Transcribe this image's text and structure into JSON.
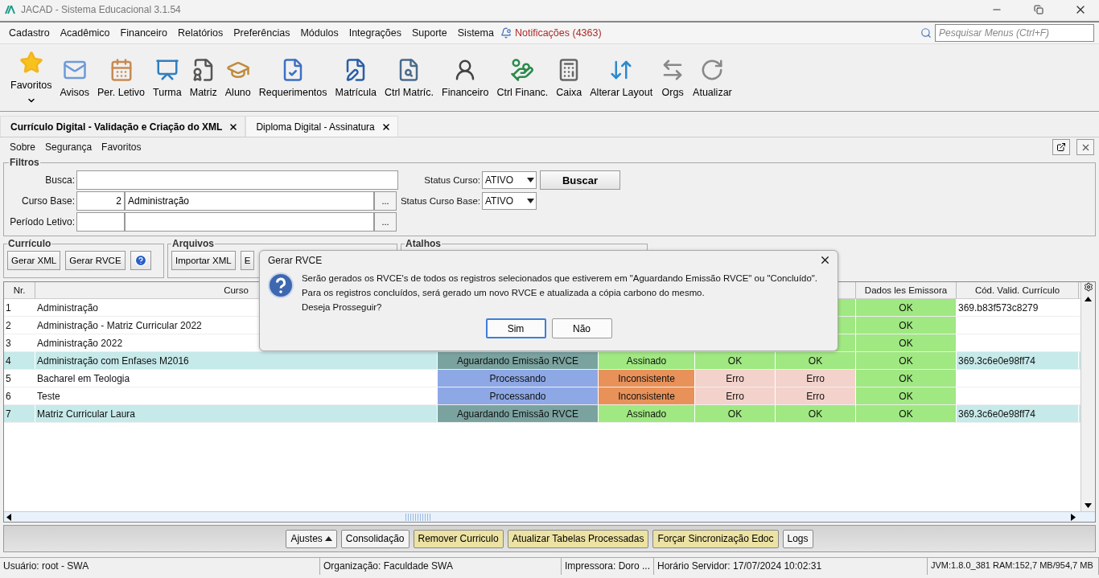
{
  "window": {
    "title": "JACAD - Sistema Educacional 3.1.54"
  },
  "menu": [
    "Cadastro",
    "Acadêmico",
    "Financeiro",
    "Relatórios",
    "Preferências",
    "Módulos",
    "Integrações",
    "Suporte",
    "Sistema"
  ],
  "notifications": "Notificações (4363)",
  "menu_search": {
    "placeholder": "Pesquisar Menus (Ctrl+F)"
  },
  "toolbar": [
    {
      "label": "Favoritos"
    },
    {
      "label": "Avisos"
    },
    {
      "label": "Per. Letivo"
    },
    {
      "label": "Turma"
    },
    {
      "label": "Matriz"
    },
    {
      "label": "Aluno"
    },
    {
      "label": "Requerimentos"
    },
    {
      "label": "Matrícula"
    },
    {
      "label": "Ctrl Matríc."
    },
    {
      "label": "Financeiro"
    },
    {
      "label": "Ctrl Financ."
    },
    {
      "label": "Caixa"
    },
    {
      "label": "Alterar Layout"
    },
    {
      "label": "Orgs"
    },
    {
      "label": "Atualizar"
    }
  ],
  "tabs": [
    {
      "label": "Currículo Digital - Validação e Criação do XML",
      "selected": true
    },
    {
      "label": "Diploma Digital - Assinatura",
      "selected": false
    }
  ],
  "submenu": [
    "Sobre",
    "Segurança",
    "Favoritos"
  ],
  "filters": {
    "title": "Filtros",
    "busca": {
      "label": "Busca:"
    },
    "curso_base": {
      "label": "Curso Base:",
      "code": "2",
      "name": "Administração",
      "lookup": "..."
    },
    "periodo": {
      "label": "Período Letivo:",
      "lookup": "..."
    },
    "status_curso": {
      "label": "Status Curso:",
      "value": "ATIVO"
    },
    "status_base": {
      "label": "Status Curso Base:",
      "value": "ATIVO"
    },
    "search_button": "Buscar"
  },
  "groups": [
    {
      "title": "Currículo",
      "buttons": [
        "Gerar XML",
        "Gerar RVCE"
      ]
    },
    {
      "title": "Arquivos",
      "buttons": [
        "Importar XML",
        "E"
      ]
    },
    {
      "title": "Atalhos"
    }
  ],
  "table": {
    "columns": [
      {
        "label": "Nr."
      },
      {
        "label": "Curso"
      },
      {},
      {},
      {},
      {},
      {
        "label": "Dados les Emissora"
      },
      {
        "label": "Cód. Valid. Currículo"
      }
    ],
    "rows": [
      {
        "nr": "1",
        "curso": "Administração",
        "selected": false,
        "cells": [
          null,
          null,
          null,
          {
            "color": "#a0e882"
          },
          {
            "text": "OK",
            "color": "#a0e882"
          },
          {
            "text": "369.b83f573c8279"
          }
        ]
      },
      {
        "nr": "2",
        "curso": "Administração - Matriz Curricular 2022",
        "selected": false,
        "cells": [
          null,
          null,
          null,
          {
            "color": "#a0e882"
          },
          {
            "text": "OK",
            "color": "#a0e882"
          },
          null
        ]
      },
      {
        "nr": "3",
        "curso": "Administração 2022",
        "selected": false,
        "cells": [
          null,
          null,
          null,
          {
            "color": "#a0e882"
          },
          {
            "text": "OK",
            "color": "#a0e882"
          },
          null
        ]
      },
      {
        "nr": "4",
        "curso": "Administração com Enfases M2016",
        "selected": true,
        "cells": [
          {
            "text": "Aguardando Emissão RVCE",
            "color": "#7aa3a0"
          },
          {
            "text": "Assinado",
            "color": "#a0e882"
          },
          {
            "text": "OK",
            "color": "#a0e882"
          },
          {
            "text": "OK",
            "color": "#a0e882"
          },
          {
            "text": "OK",
            "color": "#a0e882"
          },
          {
            "text": "369.3c6e0e98ff74"
          }
        ]
      },
      {
        "nr": "5",
        "curso": "Bacharel em Teologia",
        "selected": false,
        "cells": [
          {
            "text": "Processando",
            "color": "#8ea8e6"
          },
          {
            "text": "Inconsistente",
            "color": "#e8925a"
          },
          {
            "text": "Erro",
            "color": "#f3d2cb"
          },
          {
            "text": "Erro",
            "color": "#f3d2cb"
          },
          {
            "text": "OK",
            "color": "#a0e882"
          },
          null
        ]
      },
      {
        "nr": "6",
        "curso": "Teste",
        "selected": false,
        "cells": [
          {
            "text": "Processando",
            "color": "#8ea8e6"
          },
          {
            "text": "Inconsistente",
            "color": "#e8925a"
          },
          {
            "text": "Erro",
            "color": "#f3d2cb"
          },
          {
            "text": "Erro",
            "color": "#f3d2cb"
          },
          {
            "text": "OK",
            "color": "#a0e882"
          },
          null
        ]
      },
      {
        "nr": "7",
        "curso": "Matriz Curricular Laura",
        "selected": true,
        "cells": [
          {
            "text": "Aguardando Emissão RVCE",
            "color": "#7aa3a0"
          },
          {
            "text": "Assinado",
            "color": "#a0e882"
          },
          {
            "text": "OK",
            "color": "#a0e882"
          },
          {
            "text": "OK",
            "color": "#a0e882"
          },
          {
            "text": "OK",
            "color": "#a0e882"
          },
          {
            "text": "369.3c6e0e98ff74"
          }
        ]
      }
    ]
  },
  "actions": [
    {
      "label": "Ajustes",
      "highlighted": false
    },
    {
      "label": "Consolidação",
      "highlighted": false
    },
    {
      "label": "Remover Curriculo",
      "highlighted": true
    },
    {
      "label": "Atualizar Tabelas Processadas",
      "highlighted": true
    },
    {
      "label": "Forçar Sincronização Edoc",
      "highlighted": true
    },
    {
      "label": "Logs",
      "highlighted": false
    }
  ],
  "status_bar": [
    "Usuário: root - SWA",
    "Organização: Faculdade SWA",
    "Impressora: Doro ...",
    "Horário Servidor: 17/07/2024 10:02:31",
    "JVM:1.8.0_381  RAM:152,7 MB/954,7 MB"
  ],
  "dialog": {
    "title": "Gerar RVCE",
    "lines": [
      "Serão gerados os RVCE's de todos os registros selecionados que estiverem em \"Aguardando Emissão RVCE\" ou \"Concluído\".",
      "Para os registros concluídos, será gerado um novo RVCE e atualizada a cópia carbono do mesmo.",
      "Deseja Prosseguir?"
    ],
    "buttons": [
      {
        "label": "Sim",
        "selected": true
      },
      {
        "label": "Não",
        "selected": false
      }
    ]
  }
}
